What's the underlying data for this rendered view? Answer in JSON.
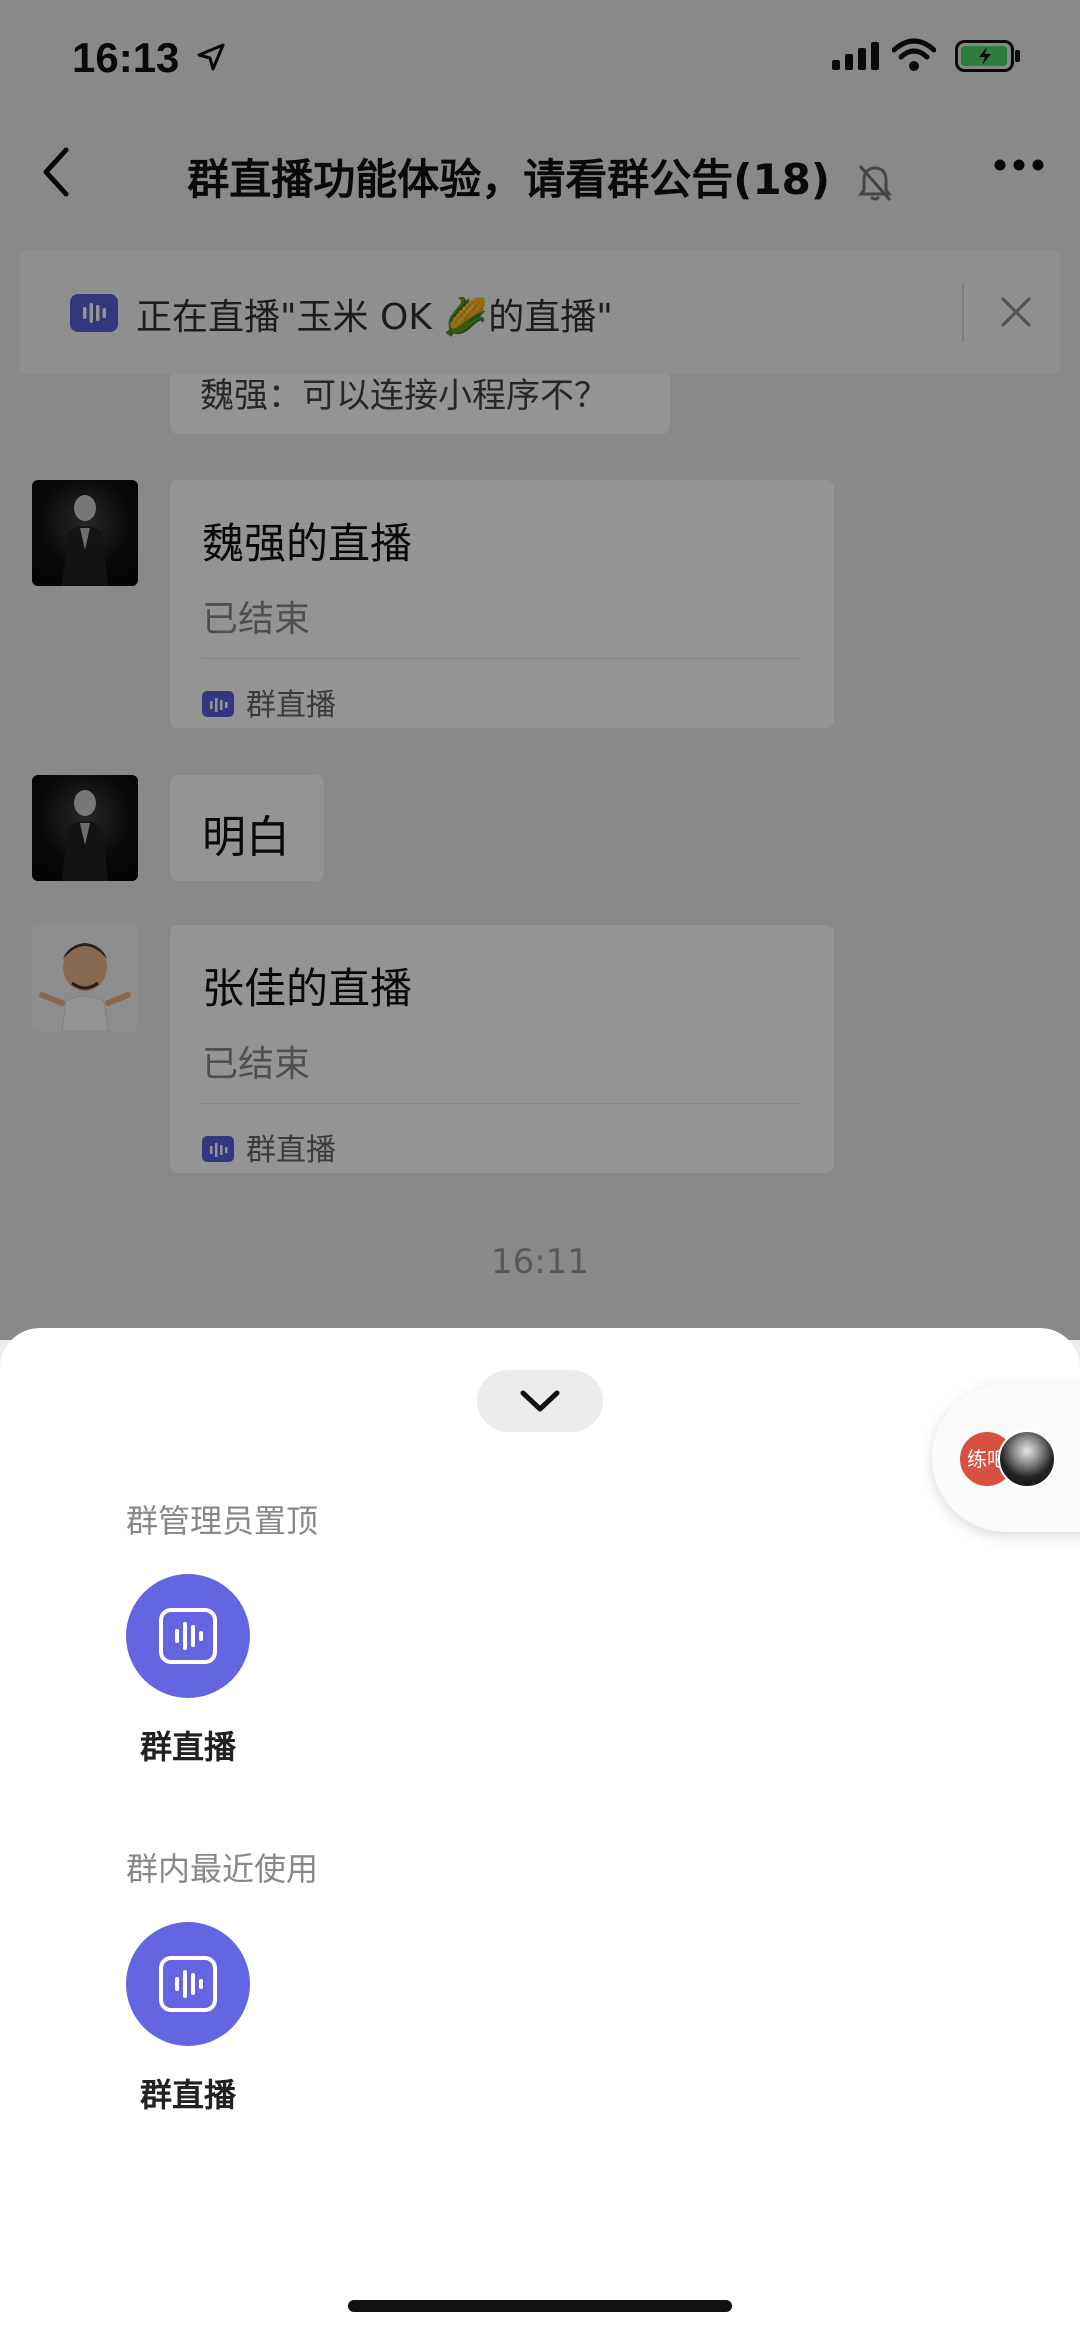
{
  "status_bar": {
    "time": "16:13"
  },
  "header": {
    "title": "群直播功能体验，请看群公告(18)"
  },
  "live_banner": {
    "text": "正在直播\"玉米 OK 🌽的直播\""
  },
  "messages": {
    "clipped_text": "魏强：可以连接小程序不？",
    "card1": {
      "title": "魏强的直播",
      "status": "已结束",
      "footer": "群直播"
    },
    "text_message": "明白",
    "card2": {
      "title": "张佳的直播",
      "status": "已结束",
      "footer": "群直播"
    },
    "timestamp": "16:11"
  },
  "sheet": {
    "floating_avatar_text": "练吧",
    "sections": [
      {
        "label": "群管理员置顶",
        "app_label": "群直播"
      },
      {
        "label": "群内最近使用",
        "app_label": "群直播"
      }
    ]
  },
  "colors": {
    "accent": "#6366e0",
    "badge": "#5b5fd8"
  }
}
